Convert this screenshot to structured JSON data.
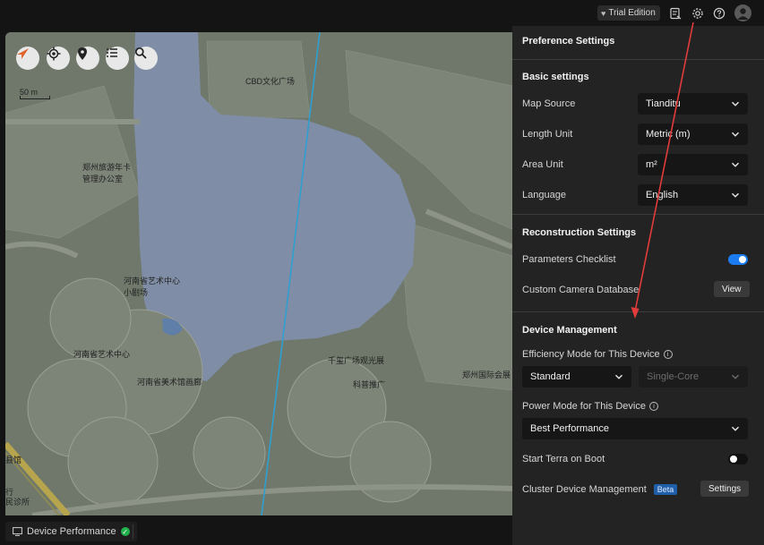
{
  "topbar": {
    "trial_label": "Trial Edition",
    "icons": [
      "heart-icon",
      "release-notes-icon",
      "gear-icon",
      "help-icon",
      "avatar"
    ]
  },
  "map": {
    "scale_label": "50 m",
    "tools": [
      "compass-icon",
      "locate-icon",
      "pin-icon",
      "list-icon",
      "search-icon"
    ],
    "labels": {
      "cbd": "CBD文化广场",
      "tourism1": "郑州旅游年卡",
      "tourism2": "管理办公室",
      "art_center1": "河南省艺术中心",
      "art_center2": "小剧场",
      "art_center3": "河南省艺术中心",
      "art_museum": "河南省美术馆画廊",
      "qianxi1": "千玺广场观光展",
      "qianxi2": "科普推广",
      "expo": "郑州国际会展",
      "edge1": "县馆",
      "edge2": "行",
      "edge3": "民诊所"
    }
  },
  "bottom": {
    "device_performance": "Device Performance"
  },
  "panel": {
    "title": "Preference Settings",
    "basic": {
      "title": "Basic settings",
      "map_source_label": "Map Source",
      "map_source_value": "Tianditu",
      "length_unit_label": "Length Unit",
      "length_unit_value": "Metric (m)",
      "area_unit_label": "Area Unit",
      "area_unit_value": "m²",
      "language_label": "Language",
      "language_value": "English"
    },
    "reconstruction": {
      "title": "Reconstruction Settings",
      "params_checklist_label": "Parameters Checklist",
      "params_checklist_on": true,
      "camera_db_label": "Custom Camera Database",
      "camera_db_button": "View"
    },
    "device": {
      "title": "Device Management",
      "efficiency_label": "Efficiency Mode for This Device",
      "efficiency_value": "Standard",
      "efficiency_secondary": "Single-Core",
      "power_label": "Power Mode for This Device",
      "power_value": "Best Performance",
      "boot_label": "Start Terra on Boot",
      "boot_on": false,
      "cluster_label": "Cluster Device Management",
      "cluster_badge": "Beta",
      "cluster_button": "Settings"
    }
  },
  "colors": {
    "accent": "#1a7cf0",
    "annotation_arrow": "#e23b3b",
    "water": "#7f8da6",
    "land": "#6f786a"
  }
}
